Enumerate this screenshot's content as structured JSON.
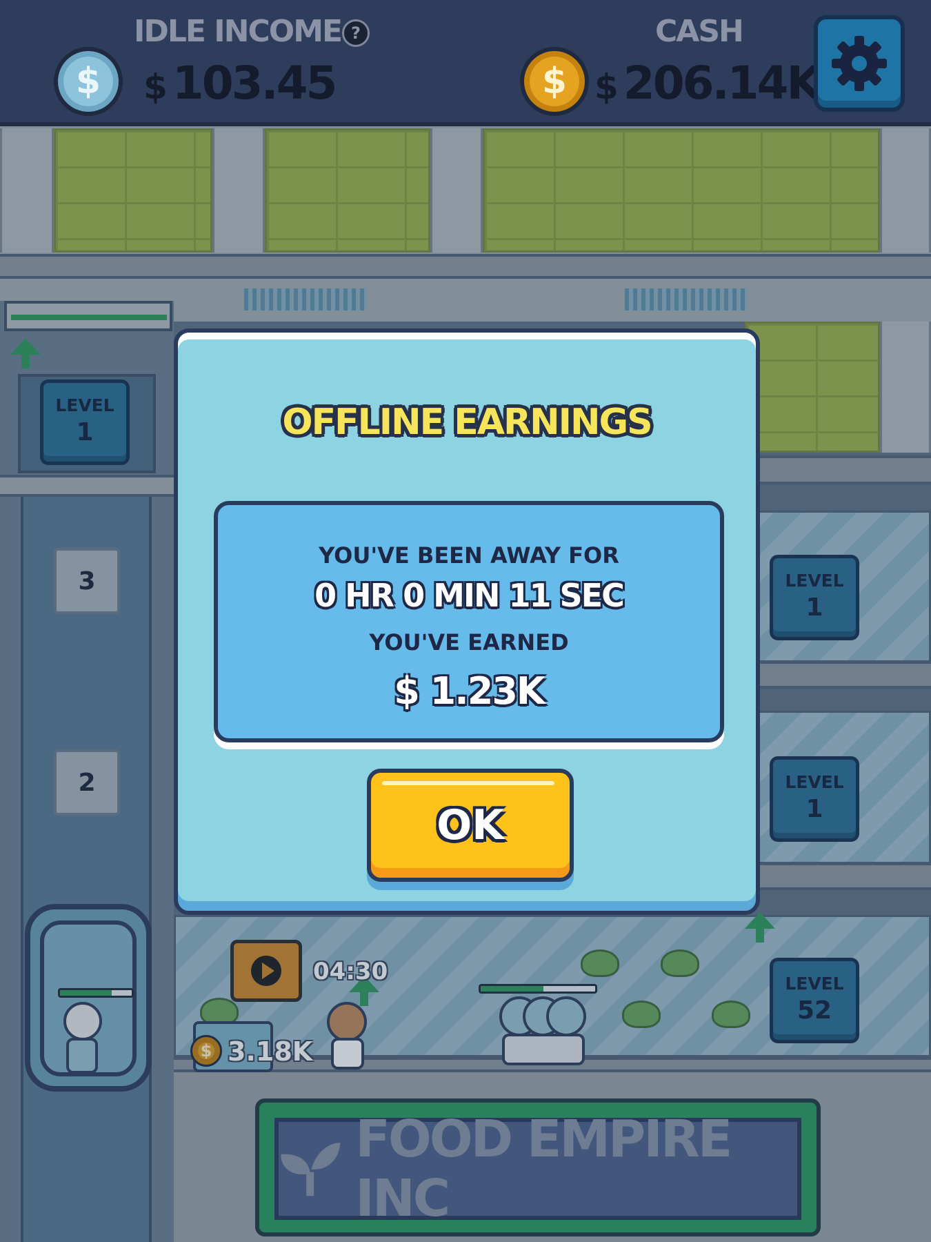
{
  "hud": {
    "idle_income_label": "IDLE INCOME",
    "idle_income_currency": "$",
    "idle_income_value": "103.45",
    "cash_label": "CASH",
    "cash_currency": "$",
    "cash_value": "206.14K",
    "help_glyph": "?",
    "icons": [
      "dollar-coin-icon",
      "help-icon",
      "gear-icon"
    ]
  },
  "shaft": {
    "level_label": "LEVEL",
    "level_value": "1",
    "floor_numbers": [
      "3",
      "2"
    ],
    "worker_progress": 0.72
  },
  "floors": [
    {
      "level_label": "LEVEL",
      "level_value": "1"
    },
    {
      "level_label": "LEVEL",
      "level_value": "1"
    },
    {
      "level_label": "LEVEL",
      "level_value": "52",
      "workers_progress": 0.55
    }
  ],
  "ground_floor": {
    "video_timer": "04:30",
    "collect_currency": "$",
    "collect_value": "3.18K"
  },
  "sign": {
    "title": "FOOD EMPIRE INC"
  },
  "dialog": {
    "title": "OFFLINE EARNINGS",
    "away_label": "YOU'VE BEEN AWAY FOR",
    "away_time": "0 HR 0 MIN 11 SEC",
    "earned_label": "YOU'VE EARNED",
    "earned_currency": "$",
    "earned_value": "1.23K",
    "ok_label": "OK"
  },
  "colors": {
    "hud_bg": "#2f3d5c",
    "dialog_bg": "#8dd3e2",
    "panel_bg": "#66bbea",
    "ok_button": "#ffc21a",
    "title_yellow": "#f6e55a",
    "accent_green": "#2f9b5c"
  }
}
